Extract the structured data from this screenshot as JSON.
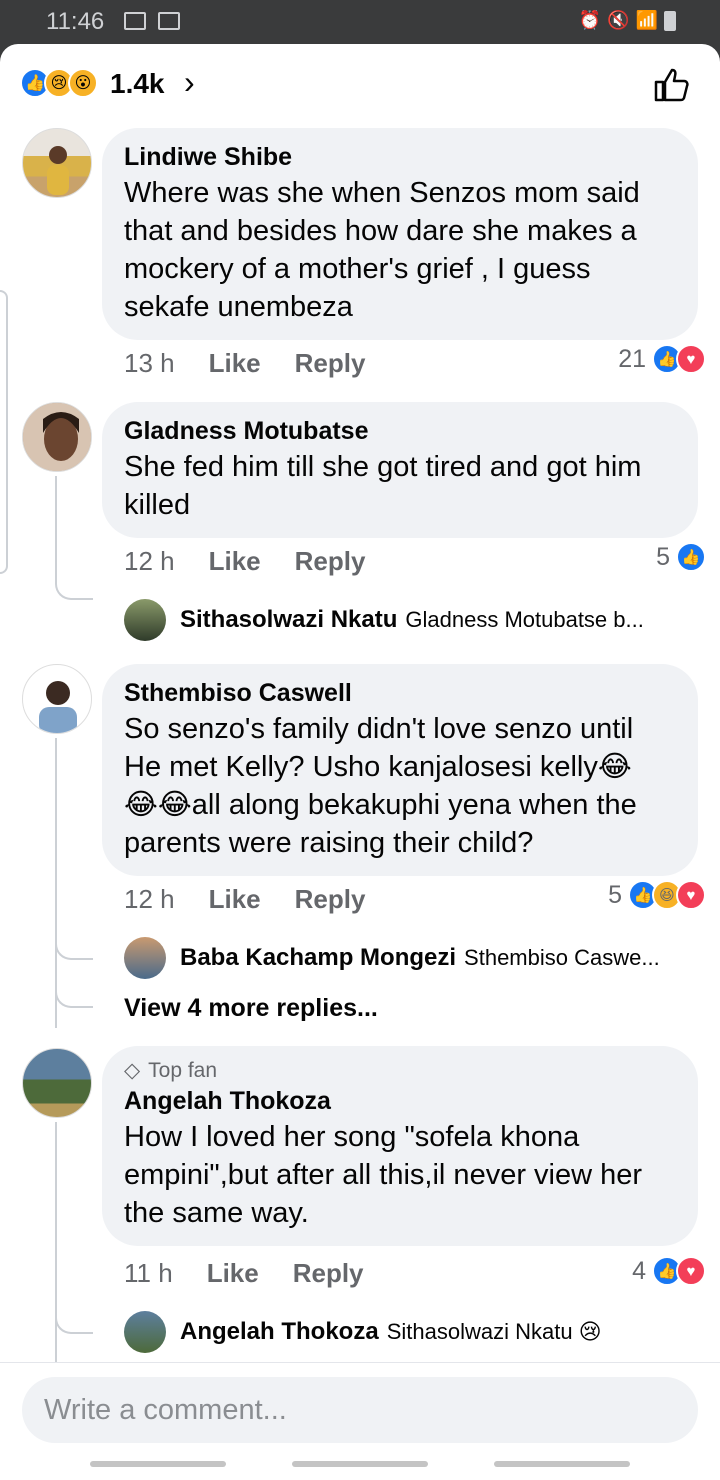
{
  "status_bar": {
    "time": "11:46"
  },
  "header": {
    "reaction_count": "1.4k"
  },
  "comments": [
    {
      "author": "Lindiwe Shibe",
      "text": "Where was she when Senzos mom said that and besides how dare she makes a mockery of a mother's grief , I guess sekafe unembeza",
      "time": "13 h",
      "like": "Like",
      "reply": "Reply",
      "reactions": "21"
    },
    {
      "author": "Gladness Motubatse",
      "text": "She fed him till she got tired and got him killed",
      "time": "12 h",
      "like": "Like",
      "reply": "Reply",
      "reactions": "5",
      "reply_preview": {
        "author": "Sithasolwazi Nkatu",
        "snippet": "Gladness Motubatse b..."
      }
    },
    {
      "author": "Sthembiso Caswell",
      "text_parts": [
        "So senzo's family didn't love senzo until He met Kelly? Usho kanjalosesi kelly",
        "all along bekakuphi yena when the parents were raising their child?"
      ],
      "time": "12 h",
      "like": "Like",
      "reply": "Reply",
      "reactions": "5",
      "reply_preview": {
        "author": "Baba Kachamp Mongezi",
        "snippet": "Sthembiso Caswe..."
      },
      "view_more": "View 4 more replies..."
    },
    {
      "badge": "Top fan",
      "author": "Angelah Thokoza",
      "text": "How I loved her song \"sofela khona empini\",but after all this,il never view her the same way.",
      "time": "11 h",
      "like": "Like",
      "reply": "Reply",
      "reactions": "4",
      "reply_preview": {
        "author": "Angelah Thokoza",
        "snippet": "Sithasolwazi Nkatu"
      }
    }
  ],
  "composer": {
    "placeholder": "Write a comment..."
  },
  "icons": {
    "like": "thumbs-up-icon",
    "love": "heart-icon",
    "sad": "sad-face-icon",
    "wow": "wow-face-icon",
    "haha": "laughing-face-icon",
    "chevron": "chevron-right-icon"
  },
  "colors": {
    "accent": "#1877f2",
    "love": "#f33e58",
    "emoji": "#f7b125"
  }
}
